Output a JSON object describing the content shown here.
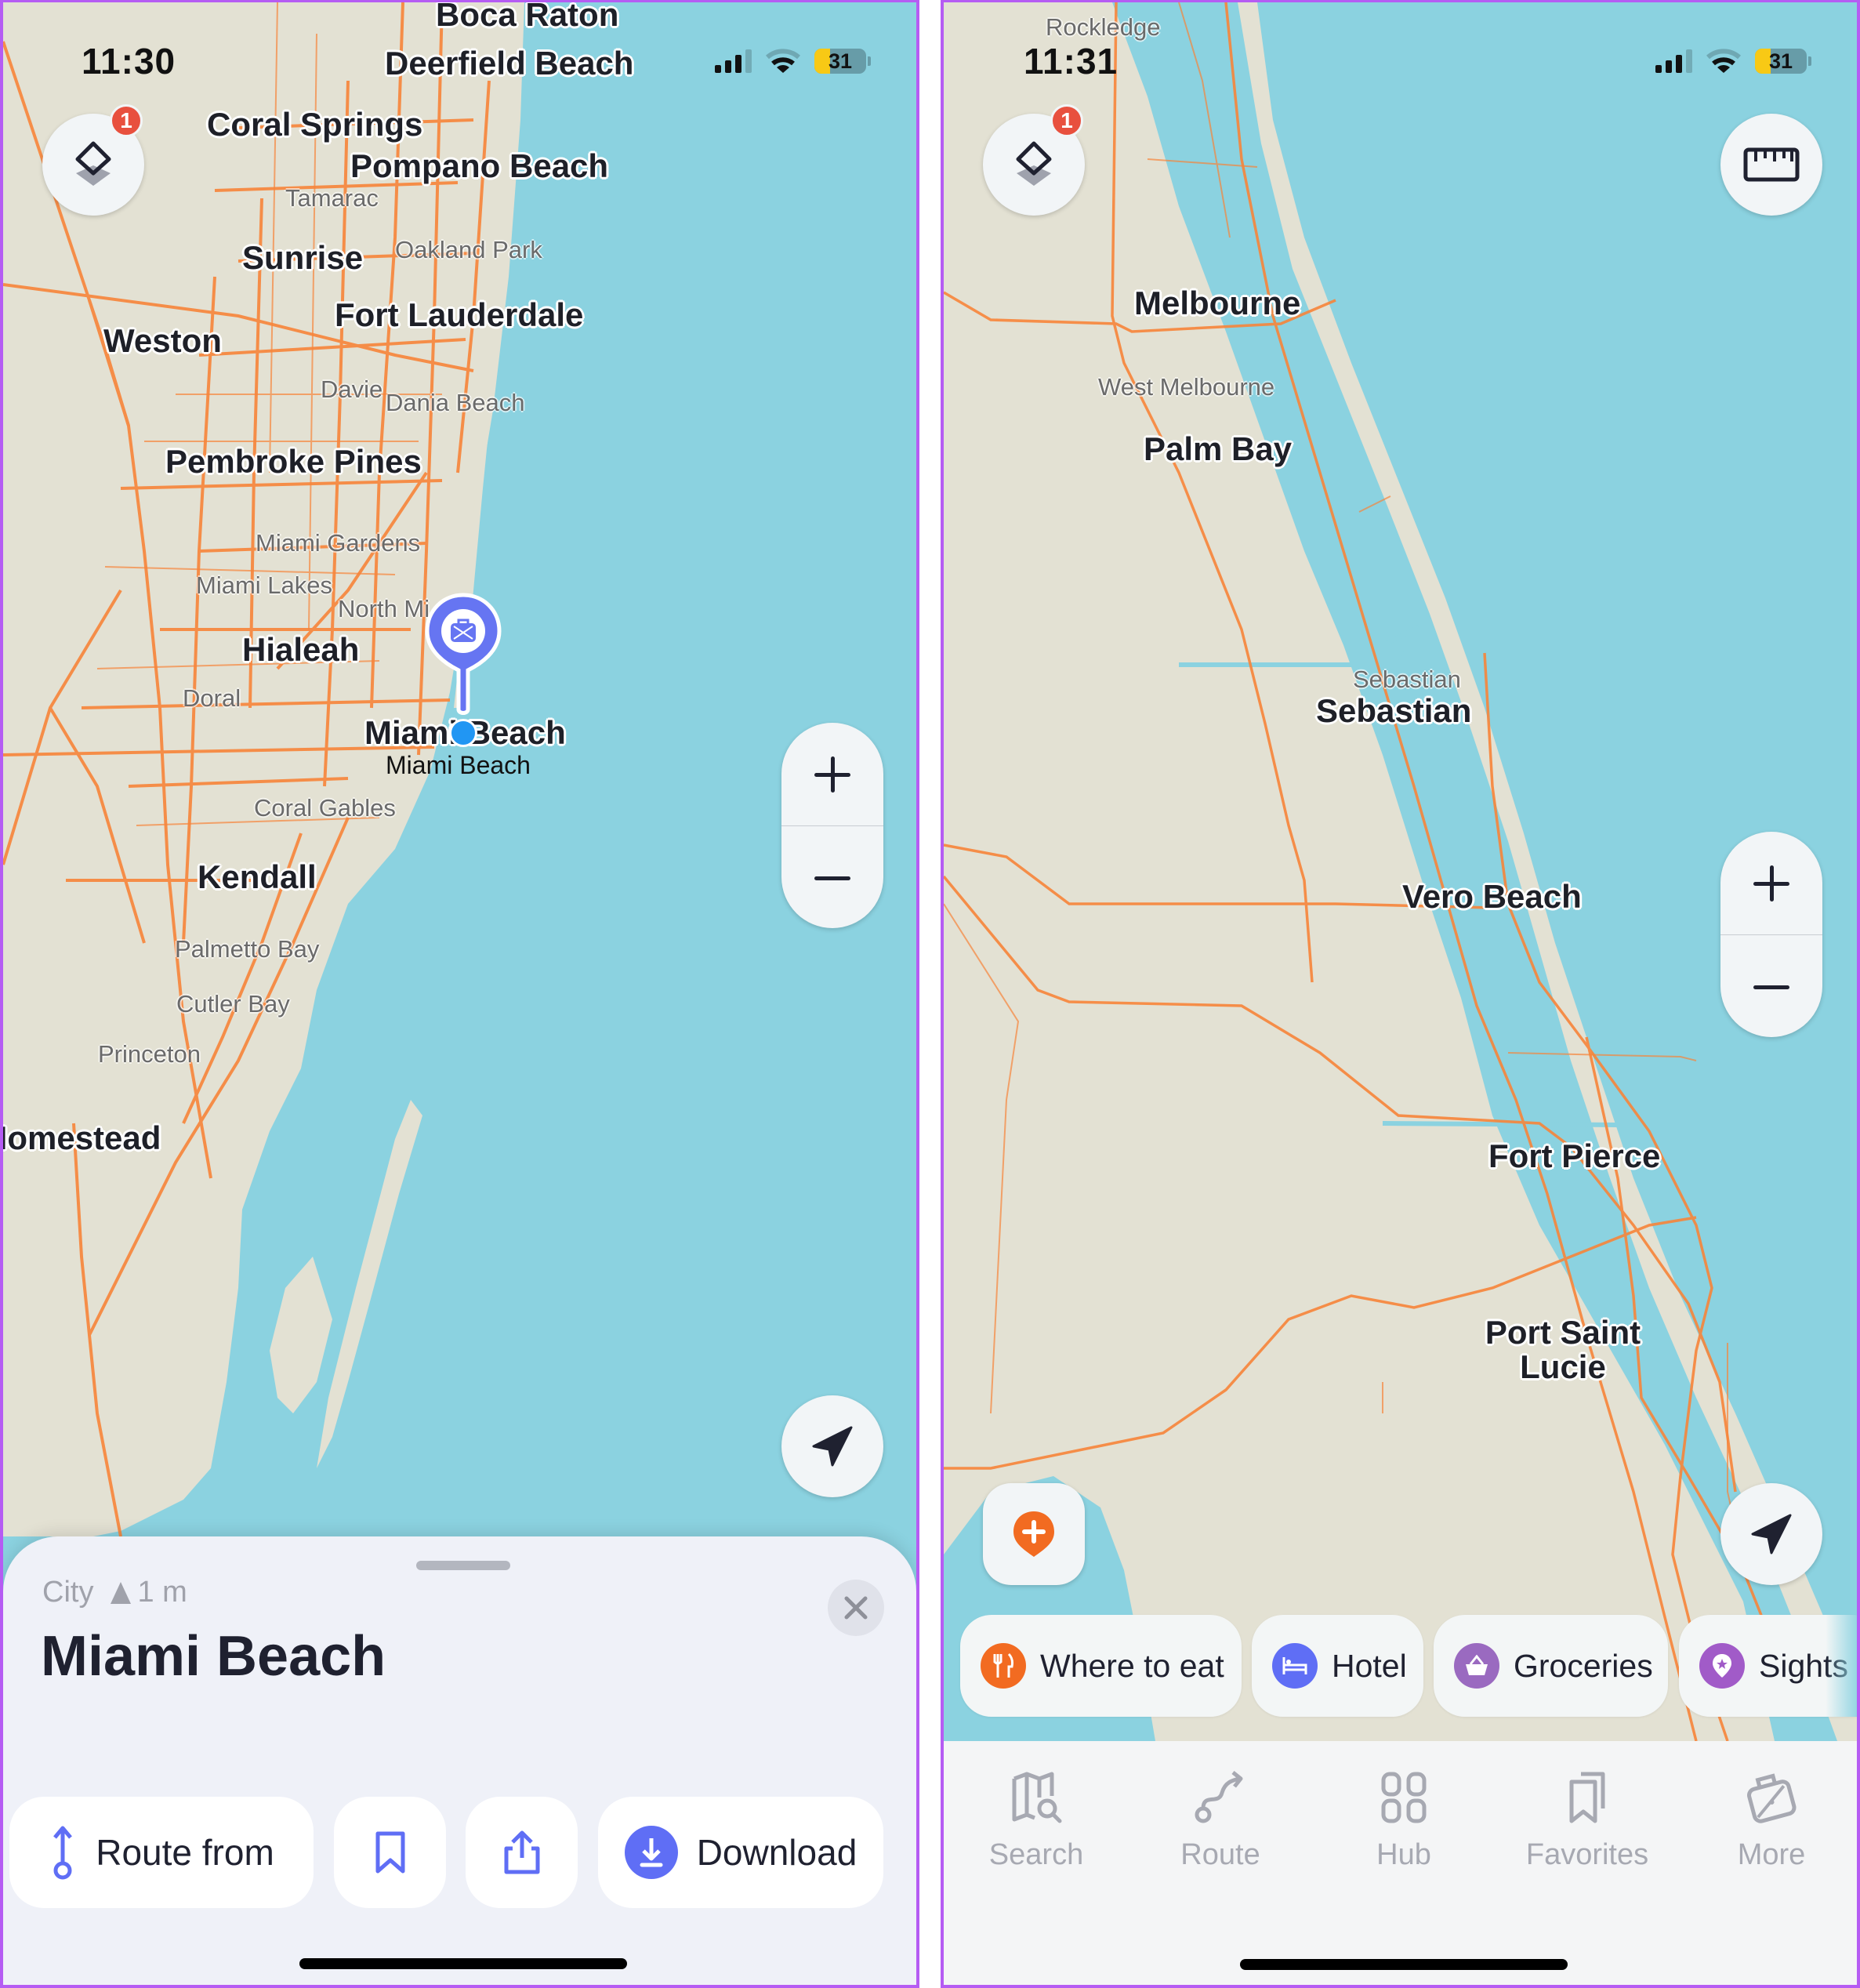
{
  "left_screen": {
    "status_bar": {
      "time": "11:30",
      "battery": "31"
    },
    "layers_button": {
      "icon": "layers-icon",
      "badge": "1"
    },
    "map_labels": {
      "boca_raton": "Boca Raton",
      "deerfield_beach": "Deerfield Beach",
      "coral_springs": "Coral Springs",
      "pompano_beach": "Pompano Beach",
      "tamarac": "Tamarac",
      "sunrise": "Sunrise",
      "oakland_park": "Oakland Park",
      "fort_lauderdale": "Fort Lauderdale",
      "weston": "Weston",
      "davie": "Davie",
      "dania_beach": "Dania Beach",
      "pembroke_pines": "Pembroke Pines",
      "miami_gardens": "Miami Gardens",
      "miami_lakes": "Miami Lakes",
      "north_miami": "North Mi",
      "hialeah": "Hialeah",
      "doral": "Doral",
      "miami_beach_major": "Miami Beach",
      "miami_beach_sub": "Miami Beach",
      "coral_gables": "Coral Gables",
      "kendall": "Kendall",
      "palmetto_bay": "Palmetto Bay",
      "cutler_bay": "Cutler Bay",
      "princeton": "Princeton",
      "homestead": "Homestead"
    },
    "zoom_controls": {
      "zoom_in": "+",
      "zoom_out": "−"
    },
    "place_sheet": {
      "type": "City",
      "elevation": "1 m",
      "title": "Miami Beach",
      "actions": {
        "route_from": "Route from",
        "bookmark": "bookmark-icon",
        "share": "share-icon",
        "download": "Download"
      }
    }
  },
  "right_screen": {
    "status_bar": {
      "time": "11:31",
      "battery": "31"
    },
    "layers_button": {
      "icon": "layers-icon",
      "badge": "1"
    },
    "ruler_button": {
      "icon": "ruler-icon"
    },
    "map_labels": {
      "rockledge": "Rockledge",
      "melbourne": "Melbourne",
      "west_melbourne": "West Melbourne",
      "palm_bay": "Palm Bay",
      "sebastian_minor": "Sebastian",
      "sebastian_major": "Sebastian",
      "vero_beach": "Vero Beach",
      "fort_pierce": "Fort Pierce",
      "port_saint_lucie": "Port Saint Lucie"
    },
    "zoom_controls": {
      "zoom_in": "+",
      "zoom_out": "−"
    },
    "categories": [
      {
        "label": "Where to eat",
        "color": "#f26b21"
      },
      {
        "label": "Hotel",
        "color": "#5f6ef5"
      },
      {
        "label": "Groceries",
        "color": "#9a6ac0"
      },
      {
        "label": "Sights",
        "color": "#a15bc8"
      }
    ],
    "tab_bar": [
      {
        "label": "Search"
      },
      {
        "label": "Route"
      },
      {
        "label": "Hub"
      },
      {
        "label": "Favorites"
      },
      {
        "label": "More"
      }
    ]
  },
  "colors": {
    "water": "#8bd2e0",
    "land": "#e3e1d3",
    "road": "#f7853a",
    "accent": "#5f6ef5",
    "badge": "#e8503e",
    "frame": "#b55cf3"
  }
}
